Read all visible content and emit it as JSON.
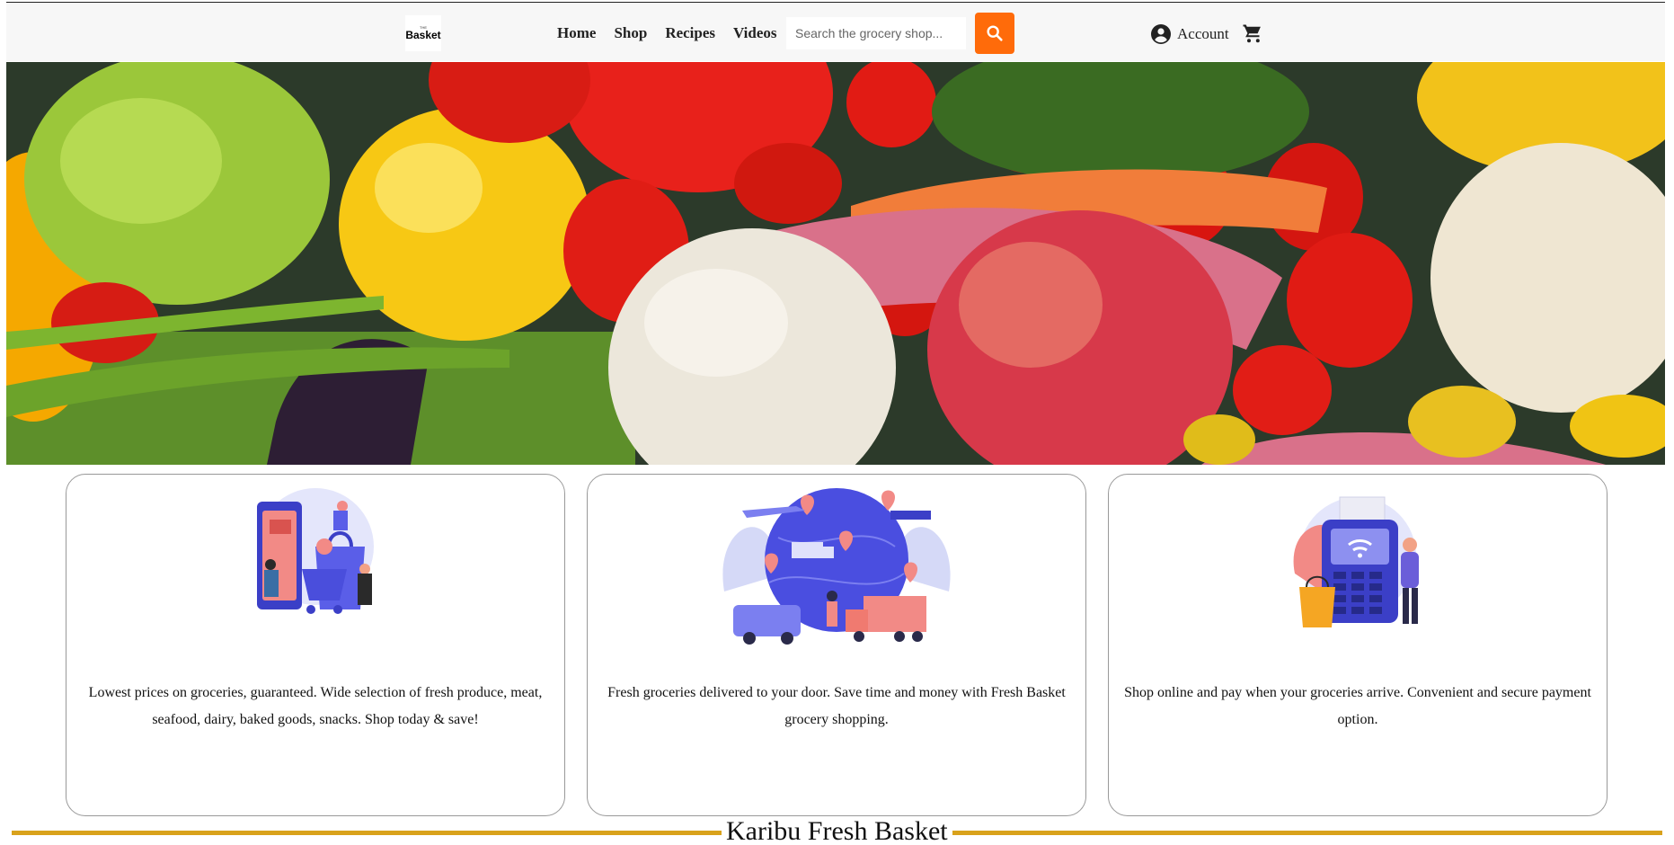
{
  "header": {
    "logo": {
      "small_text": "THE",
      "big_text": "Basket"
    },
    "nav": [
      "Home",
      "Shop",
      "Recipes",
      "Videos"
    ],
    "search": {
      "placeholder": "Search the grocery shop...",
      "value": ""
    },
    "account_label": "Account",
    "icons": {
      "search": "search-icon",
      "account": "account-circle-icon",
      "cart": "cart-icon"
    },
    "colors": {
      "search_button": "#ff6b0a"
    }
  },
  "hero": {
    "image": "vegetables-banner",
    "alt": "Fresh vegetables"
  },
  "cards": [
    {
      "illustration": "online-shopping-illustration",
      "text": "Lowest prices on groceries, guaranteed. Wide selection of fresh produce, meat, seafood, dairy, baked goods, snacks. Shop today & save!"
    },
    {
      "illustration": "global-delivery-illustration",
      "text": "Fresh groceries delivered to your door. Save time and money with Fresh Basket grocery shopping."
    },
    {
      "illustration": "payment-terminal-illustration",
      "text": "Shop online and pay when your groceries arrive. Convenient and secure payment option."
    }
  ],
  "footer": {
    "title": "Karibu Fresh Basket",
    "accent_color": "#d9a21c"
  }
}
